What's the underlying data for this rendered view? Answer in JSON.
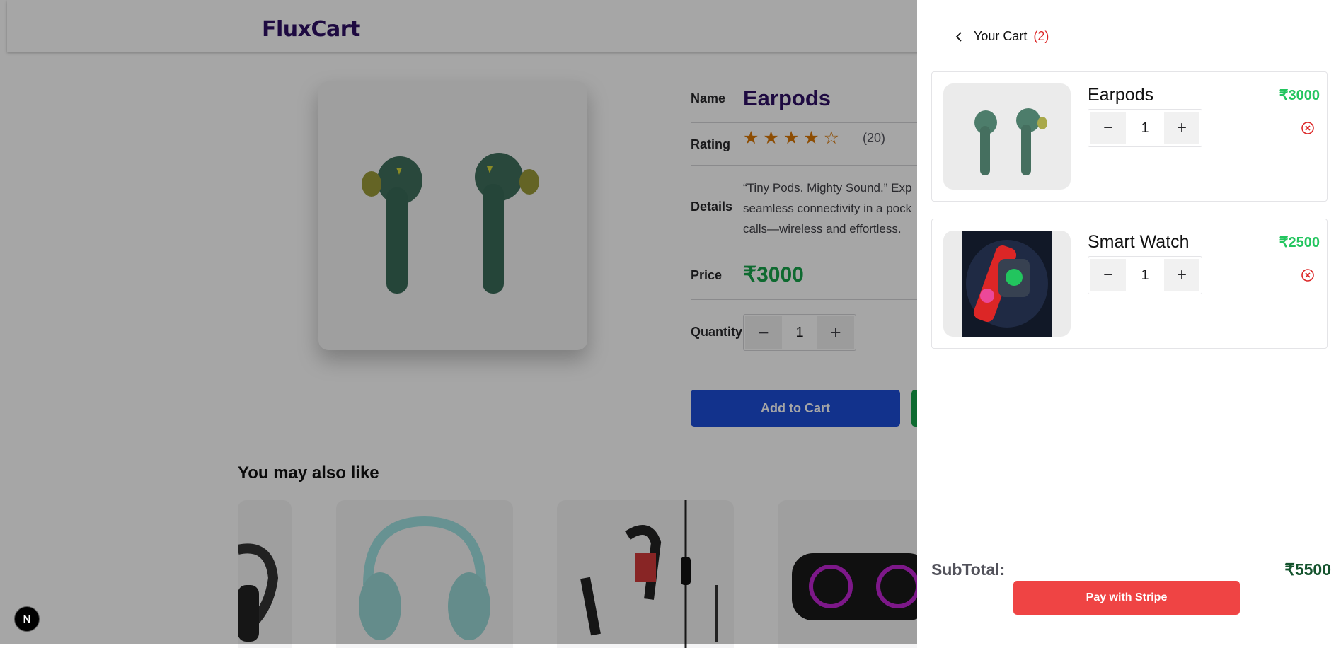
{
  "header": {
    "logo": "FluxCart"
  },
  "product": {
    "name_label": "Name",
    "name": "Earpods",
    "rating_label": "Rating",
    "stars": "★★★★☆",
    "rating_count": "(20)",
    "details_label": "Details",
    "description_lines": [
      "“Tiny Pods. Mighty Sound.” Exp",
      "seamless connectivity in a pock",
      "calls—wireless and effortless."
    ],
    "price_label": "Price",
    "price": "₹3000",
    "quantity_label": "Quantity",
    "quantity": "1",
    "add_to_cart": "Add to Cart"
  },
  "recommendations": {
    "heading": "You may also like"
  },
  "nextjs_badge": "N",
  "cart": {
    "title": "Your Cart",
    "count": "(2)",
    "items": [
      {
        "name": "Earpods",
        "price": "₹3000",
        "quantity": "1"
      },
      {
        "name": "Smart Watch",
        "price": "₹2500",
        "quantity": "1"
      }
    ],
    "subtotal_label": "SubTotal:",
    "subtotal": "₹5500",
    "pay_button": "Pay with Stripe"
  },
  "icons": {
    "back": "chevron-left-icon",
    "minus": "minus-icon",
    "plus": "plus-icon",
    "remove": "x-circle-icon"
  },
  "colors": {
    "brand": "#2e1065",
    "price_green": "#22c55e",
    "remove_red": "#dc2626",
    "stripe_red": "#ef4444",
    "add_to_cart_blue": "#1d4ed8"
  }
}
